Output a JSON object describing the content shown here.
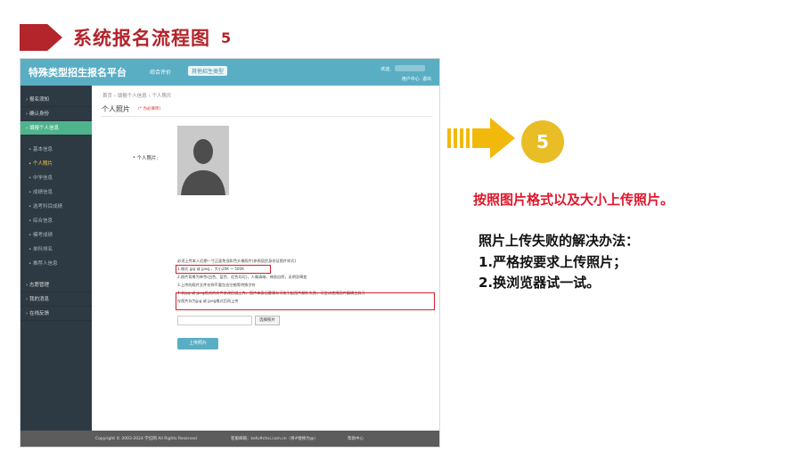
{
  "slide": {
    "title": "系统报名流程图",
    "step_number": "5",
    "step_circle": "5",
    "instruction": "按照图片格式以及大小上传照片。",
    "tips_title": "照片上传失败的解决办法：",
    "tips": [
      "1.严格按要求上传照片；",
      "2.换浏览器试一试。"
    ],
    "colors": {
      "accent_red": "#b3242b",
      "highlight_red": "#e0162b",
      "arrow_yellow": "#f2b90d",
      "circle_yellow": "#e8bd26"
    }
  },
  "portal": {
    "site_name": "特殊类型招生报名平台",
    "nav_link": "综合评价",
    "nav_button": "其他招生类型",
    "welcome": "欢迎,",
    "user_center": "用户中心",
    "logout": "退出",
    "sidebar": {
      "main_items": [
        "报名须知",
        "确认身份",
        "填报个人信息"
      ],
      "active_item": "填报个人信息",
      "sub_items": [
        "基本信息",
        "个人照片",
        "中学信息",
        "成绩信息",
        "选考科目成绩",
        "综合信息",
        "模考成绩",
        "单科排名",
        "推荐人信息"
      ],
      "active_sub": "个人照片",
      "bottom_items": [
        "志愿管理",
        "我的消息",
        "在线反馈"
      ]
    },
    "breadcrumb": [
      "首页",
      "填报个人信息",
      "个人照片"
    ],
    "page_title": "个人照片",
    "page_note": "(* 为必填项)",
    "photo_label": "* 个人照片:",
    "instructions": [
      "必须上传本人近期一寸正面免冠彩色头像照片(参照居民身份证照片样式)",
      "1.格式 jpg 或 jpeg ，大小20K ~ 500K",
      "2.照片背景为单色(白色、蓝色、红色均可)，人像清晰，神态自然，无明显畸变",
      "3.上传的照片文件名称不要包含空格等特殊字符",
      "4.非jpg 或 jpeg格式的文件修改后缀上传，图片本身因要素有可能引起图片解析失败，可尝试使用图片编辑工具另",
      "  存图片存为jpg 或 jpeg格式后再上传"
    ],
    "choose_button": "选择照片",
    "upload_button": "上传照片",
    "footer": {
      "copyright": "Copyright © 2003-2024 学信网 All Rights Reserved",
      "email": "客服邮箱：kefu#chsi.com.cn（将#替换为@）",
      "help": "帮助中心"
    },
    "colors": {
      "topbar": "#5aaec4",
      "sidebar": "#2e3a43",
      "active": "#4fb38e"
    }
  }
}
